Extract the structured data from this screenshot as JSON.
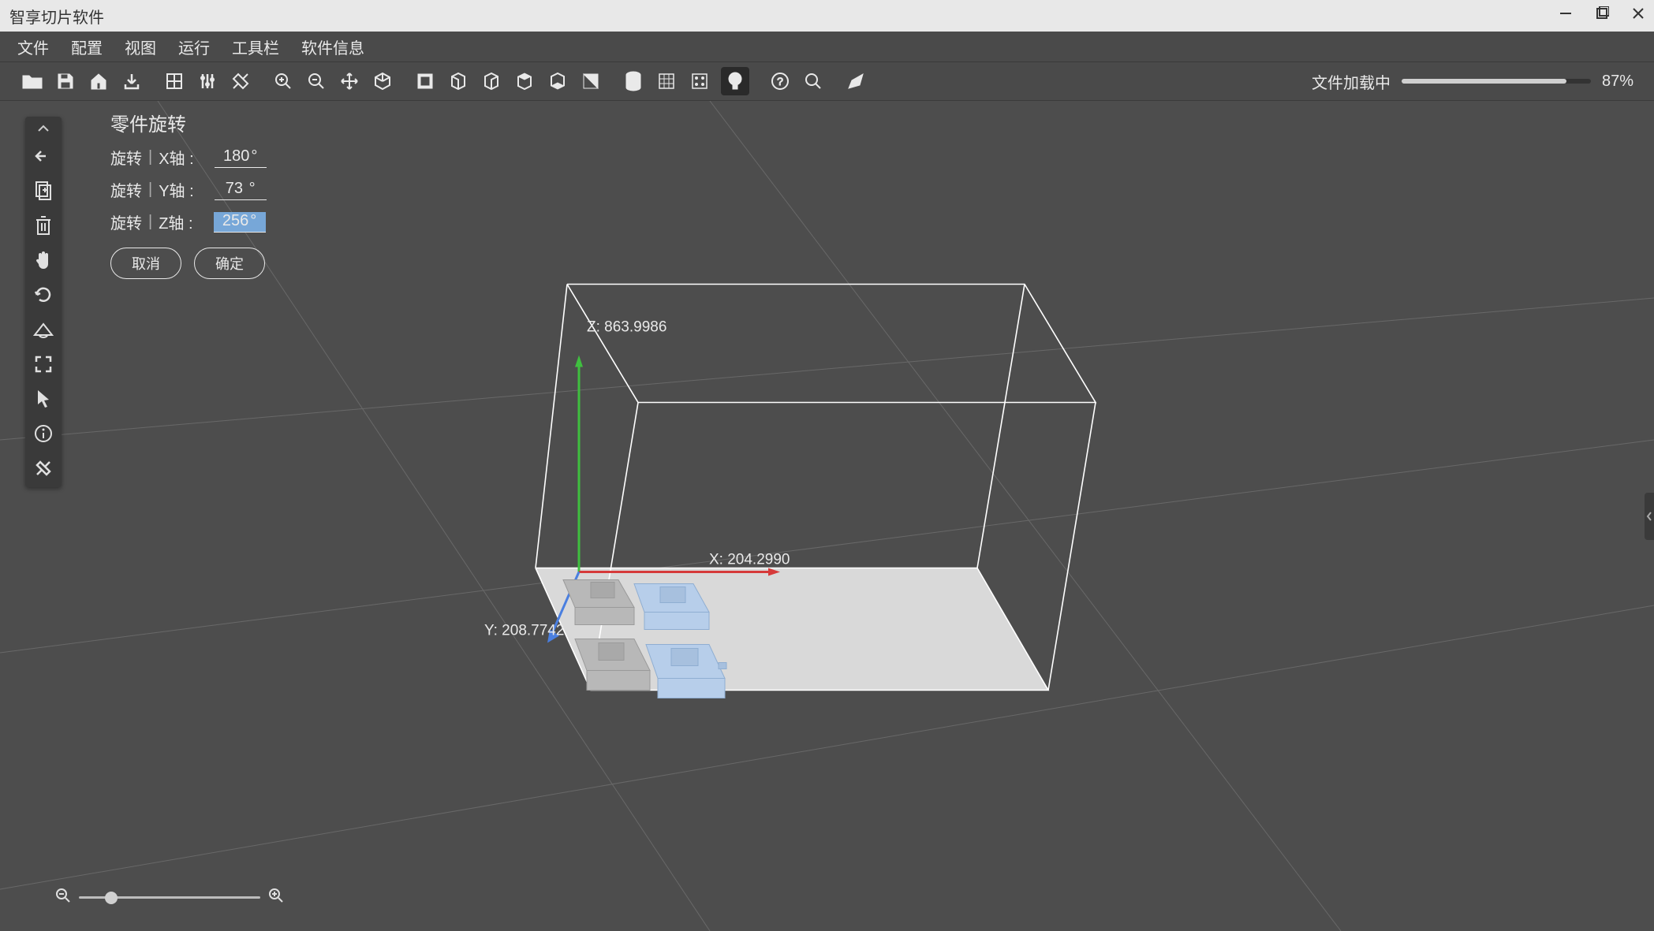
{
  "app": {
    "title": "智享切片软件"
  },
  "menu": {
    "items": [
      "文件",
      "配置",
      "视图",
      "运行",
      "工具栏",
      "软件信息"
    ]
  },
  "toolbar": {
    "loading_label": "文件加载中",
    "loading_percent": "87%",
    "loading_value": 87
  },
  "panel": {
    "title": "零件旋转",
    "rotate_label": "旋转",
    "axis_labels": {
      "x": "X轴 :",
      "y": "Y轴 :",
      "z": "Z轴 :"
    },
    "values": {
      "x": "180",
      "y": "73",
      "z": "256"
    },
    "unit": "°",
    "cancel": "取消",
    "confirm": "确定"
  },
  "scene": {
    "z_label": "Z:  863.9986",
    "x_label": "X: 204.2990",
    "y_label": "Y:  208.7742"
  },
  "zoom": {
    "value_percent": 18
  }
}
